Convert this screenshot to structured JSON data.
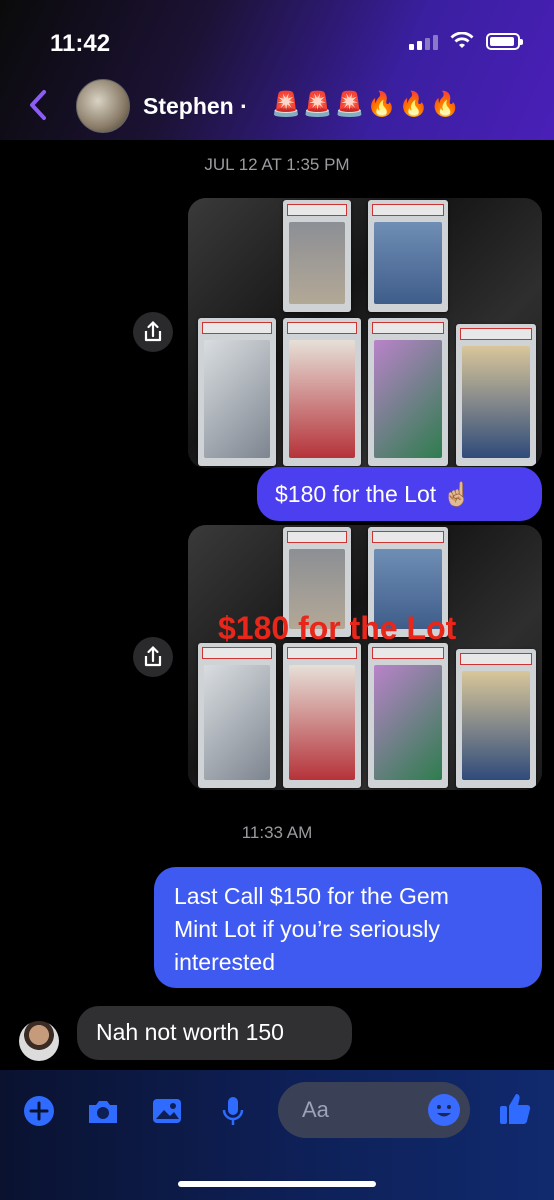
{
  "status_bar": {
    "time": "11:42"
  },
  "header": {
    "contact_name": "Stephen",
    "separator": "·",
    "emojis": "🚨🚨🚨🔥🔥🔥"
  },
  "messages": {
    "timestamp_1": "JUL 12 AT 1:35 PM",
    "bubble_1": "$180 for the Lot ☝🏼",
    "photo_overlay": "$180 for the Lot",
    "timestamp_2": "11:33 AM",
    "bubble_2_line1": "Last Call $150 for the Gem",
    "bubble_2_line2": "Mint Lot if you’re seriously",
    "bubble_2_line3": "interested",
    "incoming_1": "Nah not worth 150"
  },
  "composer": {
    "placeholder": "Aa"
  },
  "colors": {
    "accent": "#4b3ff0",
    "icon_blue": "#2f6bff",
    "back_purple": "#8b5cf6"
  }
}
